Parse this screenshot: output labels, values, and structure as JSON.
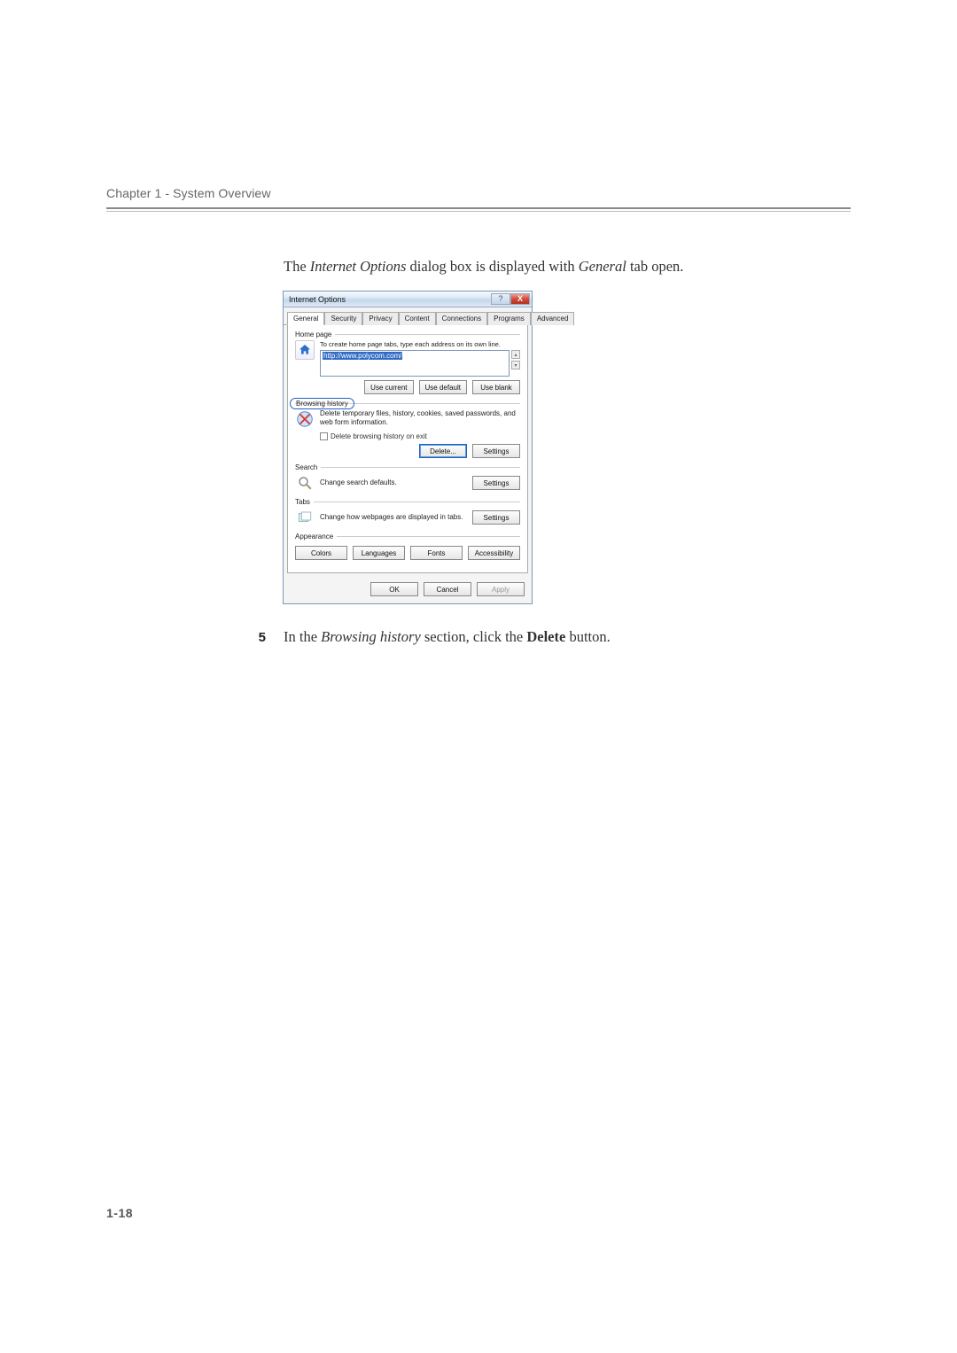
{
  "header": {
    "chapter_line": "Chapter 1 - System Overview"
  },
  "intro": {
    "pre": "The ",
    "italic1": "Internet Options",
    "mid": " dialog box is displayed with ",
    "italic2": "General",
    "post": " tab open."
  },
  "dialog": {
    "title": "Internet Options",
    "tabs": [
      "General",
      "Security",
      "Privacy",
      "Content",
      "Connections",
      "Programs",
      "Advanced"
    ],
    "home": {
      "label": "Home page",
      "hint": "To create home page tabs, type each address on its own line.",
      "url": "http://www.polycom.com/",
      "buttons": [
        "Use current",
        "Use default",
        "Use blank"
      ]
    },
    "history": {
      "label": "Browsing history",
      "desc": "Delete temporary files, history, cookies, saved passwords, and web form information.",
      "checkbox": "Delete browsing history on exit",
      "buttons": [
        "Delete...",
        "Settings"
      ]
    },
    "search": {
      "label": "Search",
      "desc": "Change search defaults.",
      "button": "Settings"
    },
    "tabs_section": {
      "label": "Tabs",
      "desc": "Change how webpages are displayed in tabs.",
      "button": "Settings"
    },
    "appearance": {
      "label": "Appearance",
      "buttons": [
        "Colors",
        "Languages",
        "Fonts",
        "Accessibility"
      ]
    },
    "footer": {
      "ok": "OK",
      "cancel": "Cancel",
      "apply": "Apply"
    }
  },
  "step": {
    "num": "5",
    "pre": "In the ",
    "italic": "Browsing history",
    "mid": " section, click the ",
    "bold": "Delete",
    "post": " button."
  },
  "page_number": "1-18"
}
